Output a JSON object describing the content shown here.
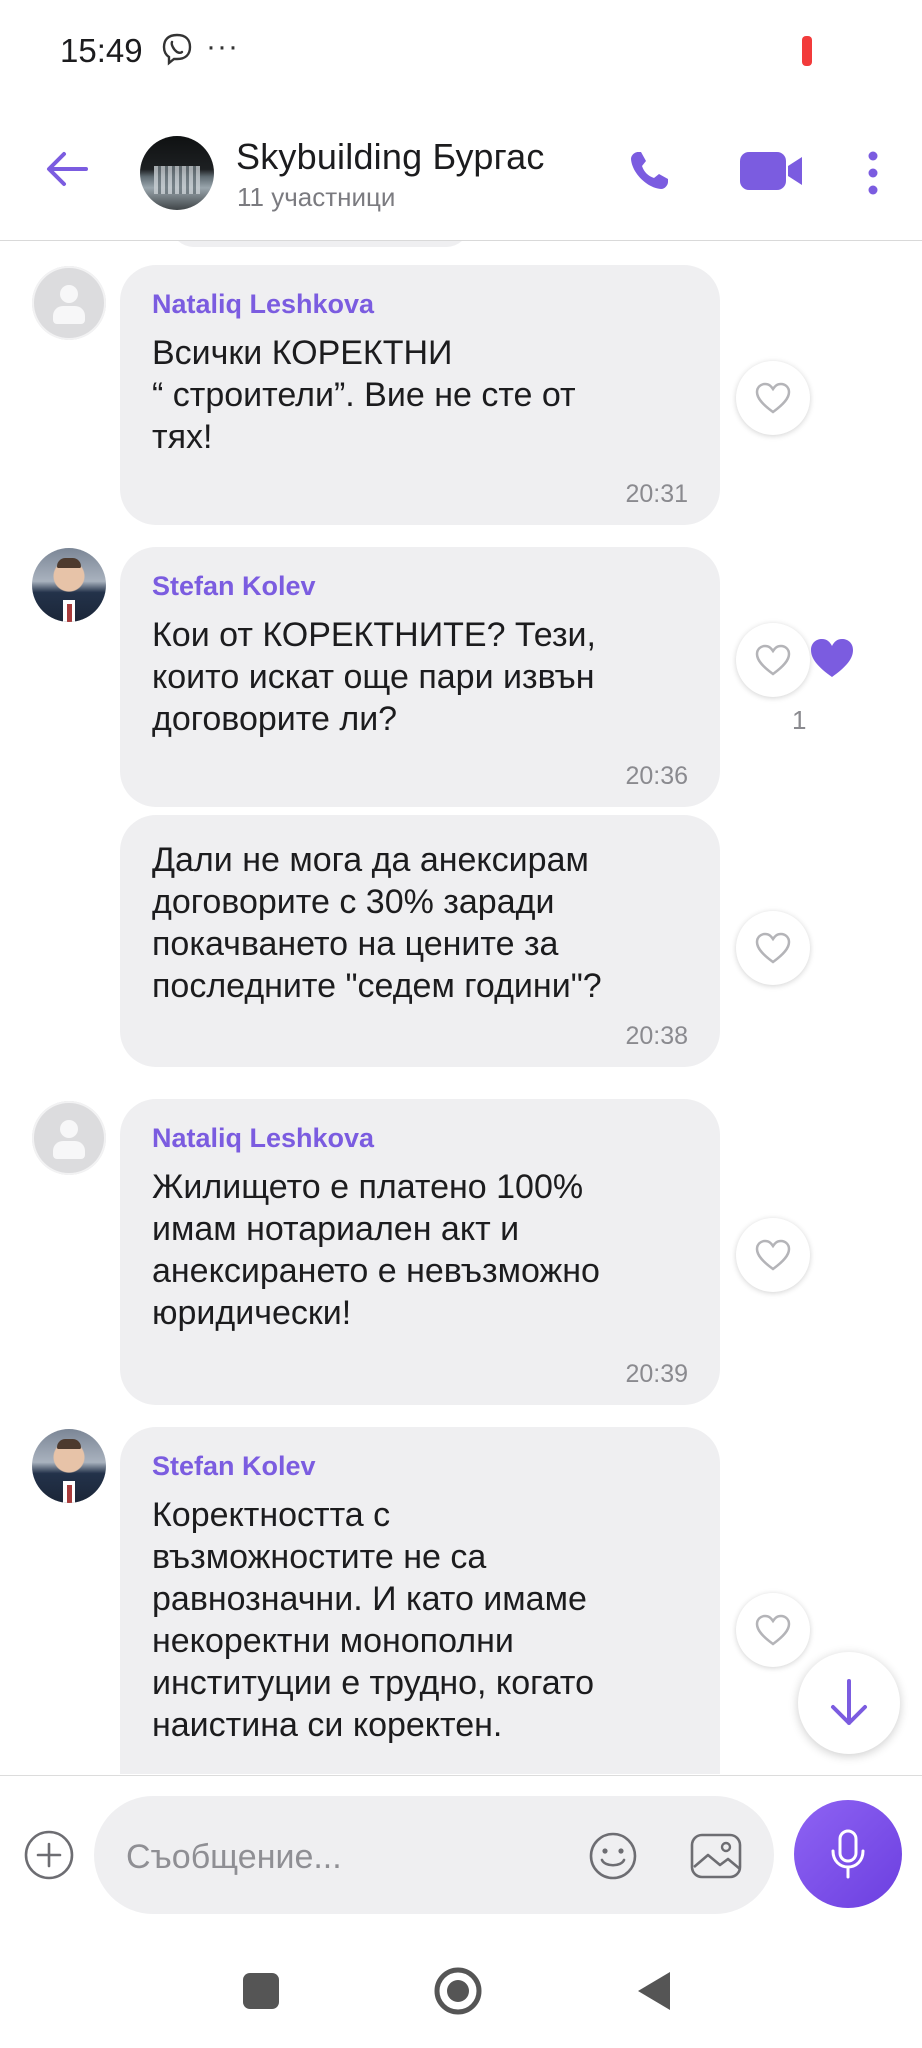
{
  "status_bar": {
    "time": "15:49",
    "more": "···"
  },
  "header": {
    "title": "Skybuilding Бургас",
    "subtitle": "11 участници"
  },
  "colors": {
    "accent": "#7b5ce0",
    "bubble": "#efeff1",
    "mic_gradient_start": "#8e63f3",
    "mic_gradient_end": "#6c3fe0"
  },
  "messages": [
    {
      "sender": "Nataliq Leshkova",
      "avatar": "placeholder",
      "text": "Всички КОРЕКТНИ\n“ строители”. Вие не сте от\nтях!",
      "time": "20:31",
      "likes": 0
    },
    {
      "sender": "Stefan Kolev",
      "avatar": "photo",
      "text": "Кои от КОРЕКТНИТЕ? Тези,\nкоито искат още пари извън\nдоговорите ли?",
      "time": "20:36",
      "likes": 1,
      "like_count": "1"
    },
    {
      "sender": "",
      "avatar": "",
      "text": "Дали не мога да анексирам\nдоговорите с 30% заради\nпокачването на цените за\nпоследните \"седем години\"?",
      "time": "20:38",
      "likes": 0
    },
    {
      "sender": "Nataliq Leshkova",
      "avatar": "placeholder",
      "text": "Жилището е платено 100%\nимам нотариален акт и\nанексирането е невъзможно\nюридически!",
      "time": "20:39",
      "likes": 0
    },
    {
      "sender": "Stefan Kolev",
      "avatar": "photo",
      "text": "Коректността с\nвъзможностите не са\nравнозначни. И като имаме\nнекоректни монополни\nинституции е трудно, когато\nнаистина си коректен.",
      "time": "",
      "likes": 0
    }
  ],
  "composer": {
    "placeholder": "Съобщение..."
  },
  "icons": {
    "back": "arrow-left-icon",
    "call": "phone-icon",
    "video": "video-camera-icon",
    "menu": "more-vertical-icon",
    "like": "heart-outline-icon",
    "liked": "heart-filled-icon",
    "scroll": "arrow-down-icon",
    "attach": "plus-circle-icon",
    "emoji": "smiley-icon",
    "gallery": "image-icon",
    "mic": "microphone-icon"
  }
}
